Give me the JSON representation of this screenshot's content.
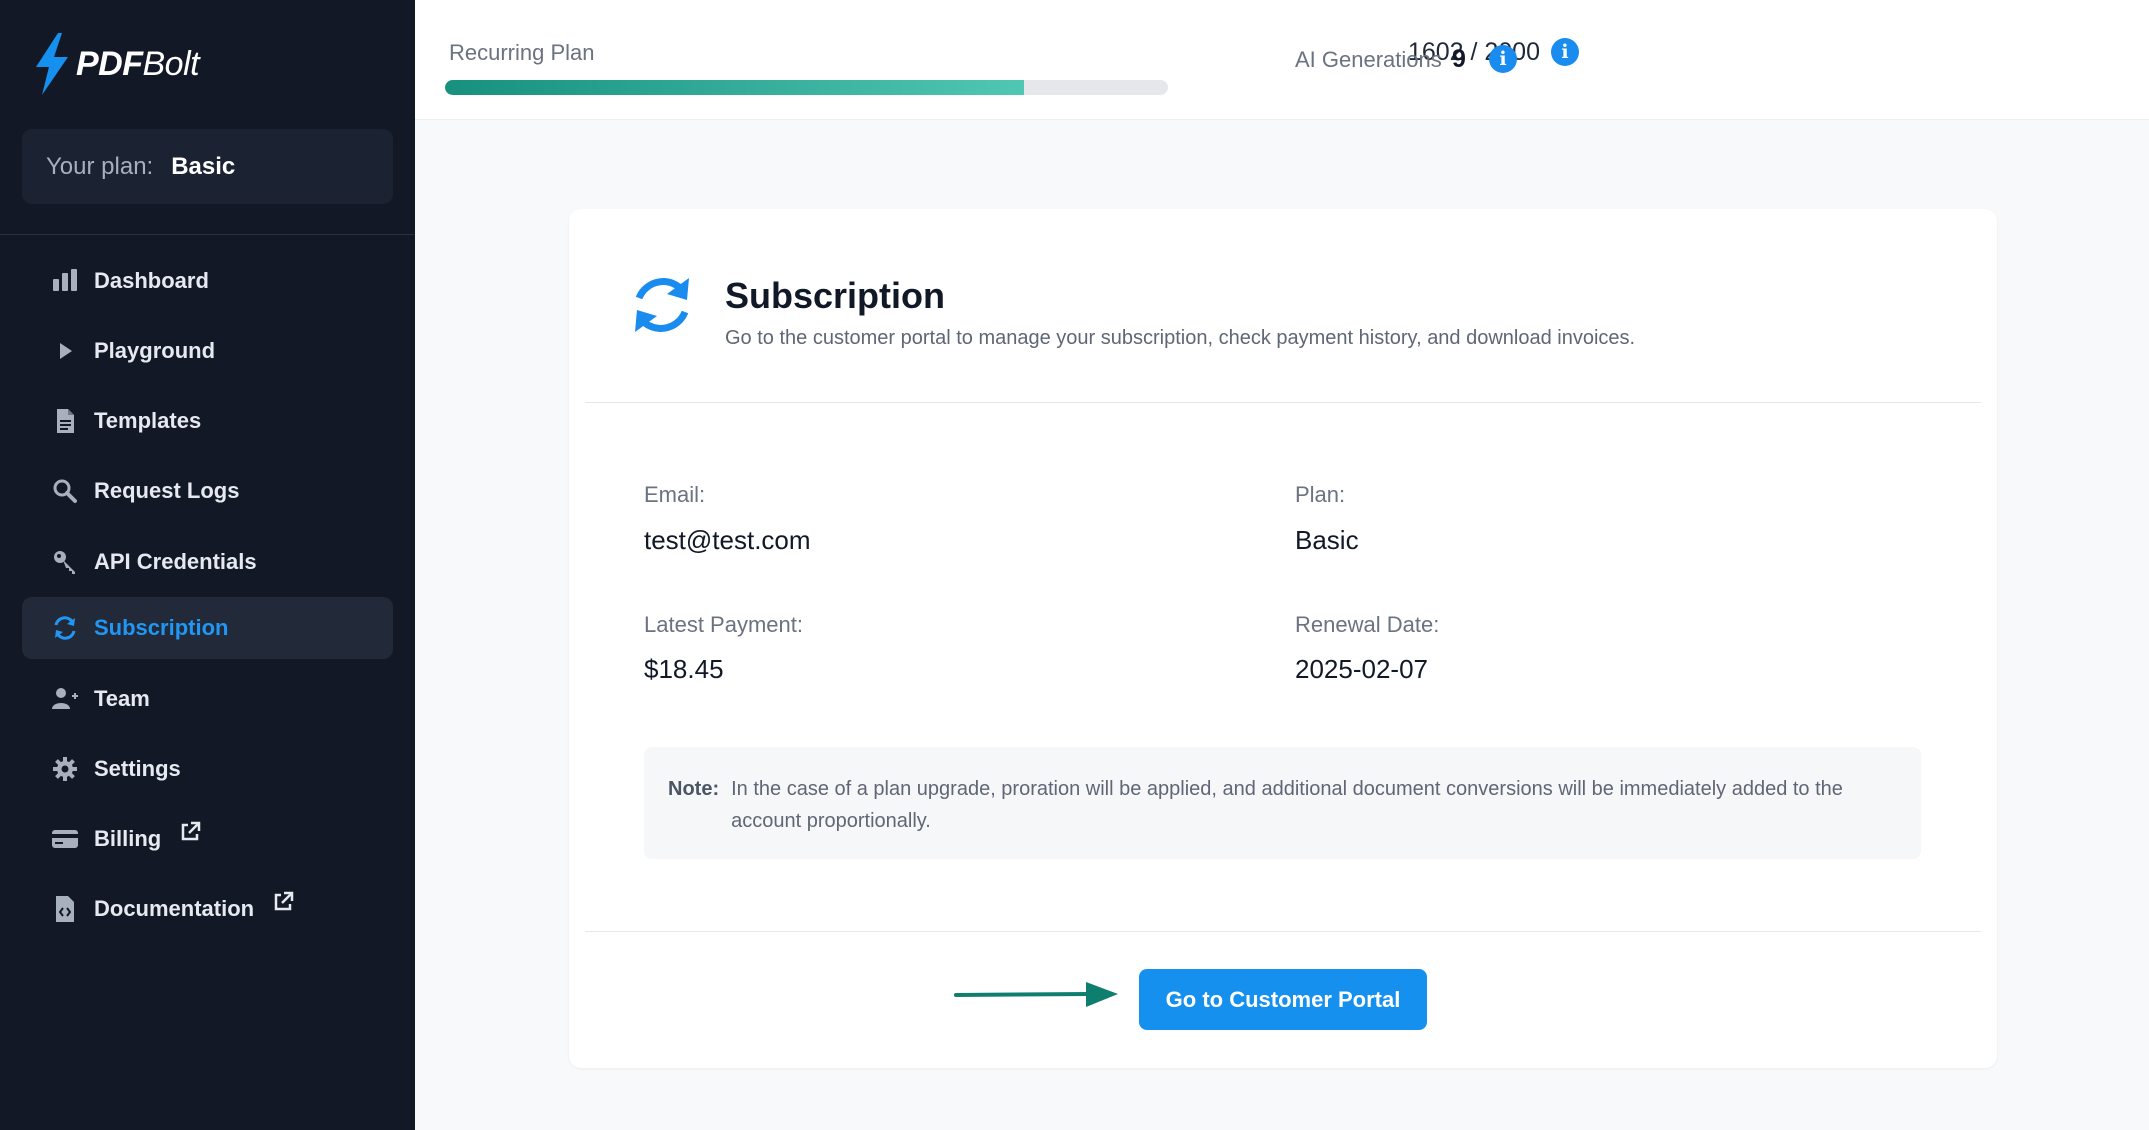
{
  "brand": {
    "name_bold": "PDF",
    "name_regular": "Bolt"
  },
  "plan_box": {
    "label": "Your plan:",
    "value": "Basic"
  },
  "sidebar": {
    "items": [
      {
        "label": "Dashboard",
        "icon": "bar-chart-icon"
      },
      {
        "label": "Playground",
        "icon": "play-icon"
      },
      {
        "label": "Templates",
        "icon": "file-icon"
      },
      {
        "label": "Request Logs",
        "icon": "search-icon"
      },
      {
        "label": "API Credentials",
        "icon": "key-icon"
      },
      {
        "label": "Subscription",
        "icon": "sync-icon",
        "active": true
      },
      {
        "label": "Team",
        "icon": "user-plus-icon"
      },
      {
        "label": "Settings",
        "icon": "gear-icon"
      },
      {
        "label": "Billing",
        "icon": "credit-card-icon",
        "external": true
      },
      {
        "label": "Documentation",
        "icon": "code-file-icon",
        "external": true
      }
    ]
  },
  "topbar": {
    "usage_label": "Recurring Plan",
    "usage_count": "1602 / 2000",
    "usage_fraction": 0.801,
    "ai_label": "AI Generations",
    "ai_count": "9",
    "info_glyph": "i"
  },
  "card": {
    "title": "Subscription",
    "subtitle": "Go to the customer portal to manage your subscription, check payment history, and download invoices.",
    "email_label": "Email:",
    "email_value": "test@test.com",
    "plan_label": "Plan:",
    "plan_value": "Basic",
    "payment_label": "Latest Payment:",
    "payment_value": "$18.45",
    "renewal_label": "Renewal Date:",
    "renewal_value": "2025-02-07",
    "note_label": "Note:",
    "note_text": "In the case of a plan upgrade, proration will be applied, and additional document conversions will be immediately added to the account proportionally.",
    "portal_button": "Go to Customer Portal"
  },
  "colors": {
    "sidebar_bg": "#121826",
    "accent": "#1590ee",
    "progress_start": "#17907e",
    "progress_end": "#4fc7b3",
    "arrow": "#0e7f6f"
  }
}
